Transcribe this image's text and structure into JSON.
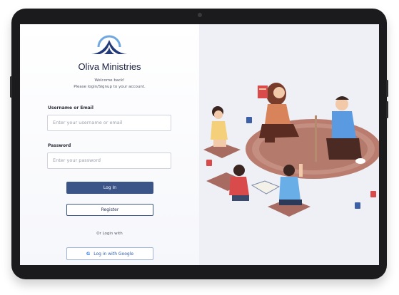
{
  "brand": {
    "name": "Oliva Ministries",
    "logo_icon": "mountain-arch-logo",
    "colors": {
      "primary": "#3c5589",
      "accent": "#4a8fd6"
    }
  },
  "welcome": {
    "line1": "Welcome back!",
    "line2": "Please login/Signup to your account."
  },
  "form": {
    "username_label": "Username or Email",
    "username_placeholder": "Enter your username or email",
    "password_label": "Password",
    "password_placeholder": "Enter your password",
    "login_button": "Log In",
    "register_button": "Register",
    "or_text": "Or Login with",
    "google_button": "Log in with Google",
    "google_icon": "google-icon"
  },
  "illustration": {
    "icon": "family-reading-illustration"
  }
}
